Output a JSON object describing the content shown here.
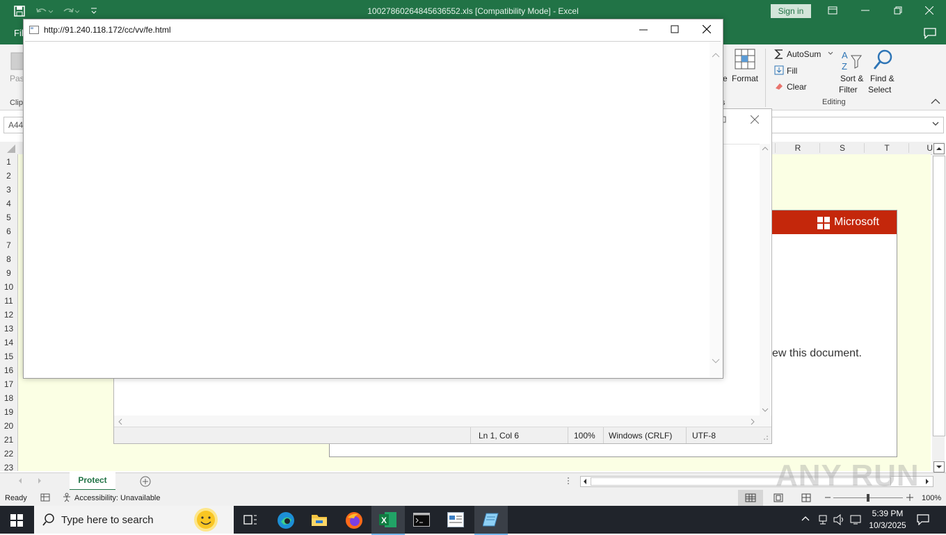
{
  "excel": {
    "window_title": "10027860264845636552.xls  [Compatibility Mode]  -  Excel",
    "sign_in": "Sign in",
    "file_tab": "File",
    "ribbon": {
      "paste_fragment": "Pas",
      "clipboard_fragment": "Clip",
      "delete_fragment": "e",
      "format_label": "Format",
      "autosum": "AutoSum",
      "fill": "Fill",
      "clear": "Clear",
      "sort_filter_line1": "Sort &",
      "sort_filter_line2": "Filter",
      "find_select_line1": "Find &",
      "find_select_line2": "Select",
      "editing_group": "Editing",
      "cells_fragment": "s"
    },
    "name_box": "A44",
    "columns": [
      "R",
      "S",
      "T",
      "U"
    ],
    "rows": [
      "1",
      "2",
      "3",
      "4",
      "5",
      "6",
      "7",
      "8",
      "9",
      "10",
      "11",
      "12",
      "13",
      "14",
      "15",
      "16",
      "17",
      "18",
      "19",
      "20",
      "21",
      "22",
      "23"
    ],
    "sheet_tab": "Protect",
    "status": {
      "ready": "Ready",
      "accessibility": "Accessibility: Unavailable",
      "zoom": "100%"
    },
    "doc_panel": {
      "brand": "Microsoft",
      "message_fragment": "ew this document."
    }
  },
  "notepad": {
    "status_position": "Ln 1, Col 6",
    "status_zoom": "100%",
    "status_eol": "Windows (CRLF)",
    "status_encoding": "UTF-8"
  },
  "popup": {
    "url": "http://91.240.118.172/cc/vv/fe.html"
  },
  "taskbar": {
    "search_placeholder": "Type here to search",
    "time": "5:39 PM",
    "date": "10/3/2025"
  },
  "watermark": "ANY RUN",
  "colors": {
    "excel_green": "#217346",
    "ms_red": "#c4270b",
    "sheet_bg": "#fbffe4",
    "taskbar": "#20242b"
  }
}
